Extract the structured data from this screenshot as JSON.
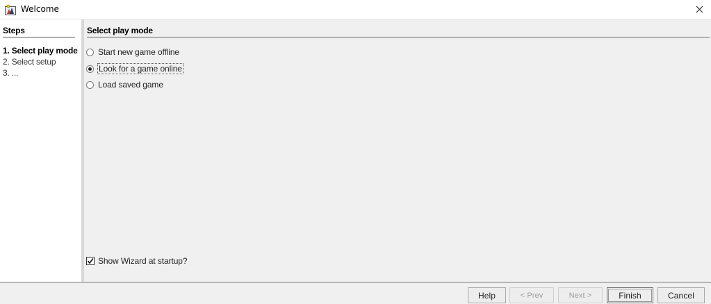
{
  "window": {
    "title": "Welcome",
    "icon": "app-icon",
    "close_icon": "close-icon"
  },
  "steps": {
    "header": "Steps",
    "items": [
      {
        "label": "1. Select play mode",
        "current": true
      },
      {
        "label": "2. Select setup",
        "current": false
      },
      {
        "label": "3. ...",
        "current": false
      }
    ]
  },
  "content": {
    "header": "Select play mode",
    "options": [
      {
        "label": "Start new game offline",
        "selected": false
      },
      {
        "label": "Look for a game online",
        "selected": true
      },
      {
        "label": "Load saved game",
        "selected": false
      }
    ],
    "show_wizard": {
      "label": "Show Wizard at startup?",
      "checked": true
    }
  },
  "buttons": {
    "help": "Help",
    "prev": "< Prev",
    "next": "Next >",
    "finish": "Finish",
    "cancel": "Cancel"
  }
}
